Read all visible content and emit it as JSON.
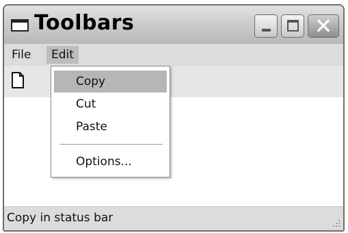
{
  "window": {
    "title": "Toolbars",
    "close_glyph": "✕"
  },
  "menubar": {
    "items": [
      {
        "label": "File"
      },
      {
        "label": "Edit"
      }
    ]
  },
  "edit_menu": {
    "items": [
      {
        "label": "Copy",
        "highlighted": true
      },
      {
        "label": "Cut"
      },
      {
        "label": "Paste"
      },
      {
        "label": "Options..."
      }
    ]
  },
  "toolbar": {
    "icons": [
      "new-document-icon"
    ]
  },
  "statusbar": {
    "text": "Copy in status bar"
  }
}
